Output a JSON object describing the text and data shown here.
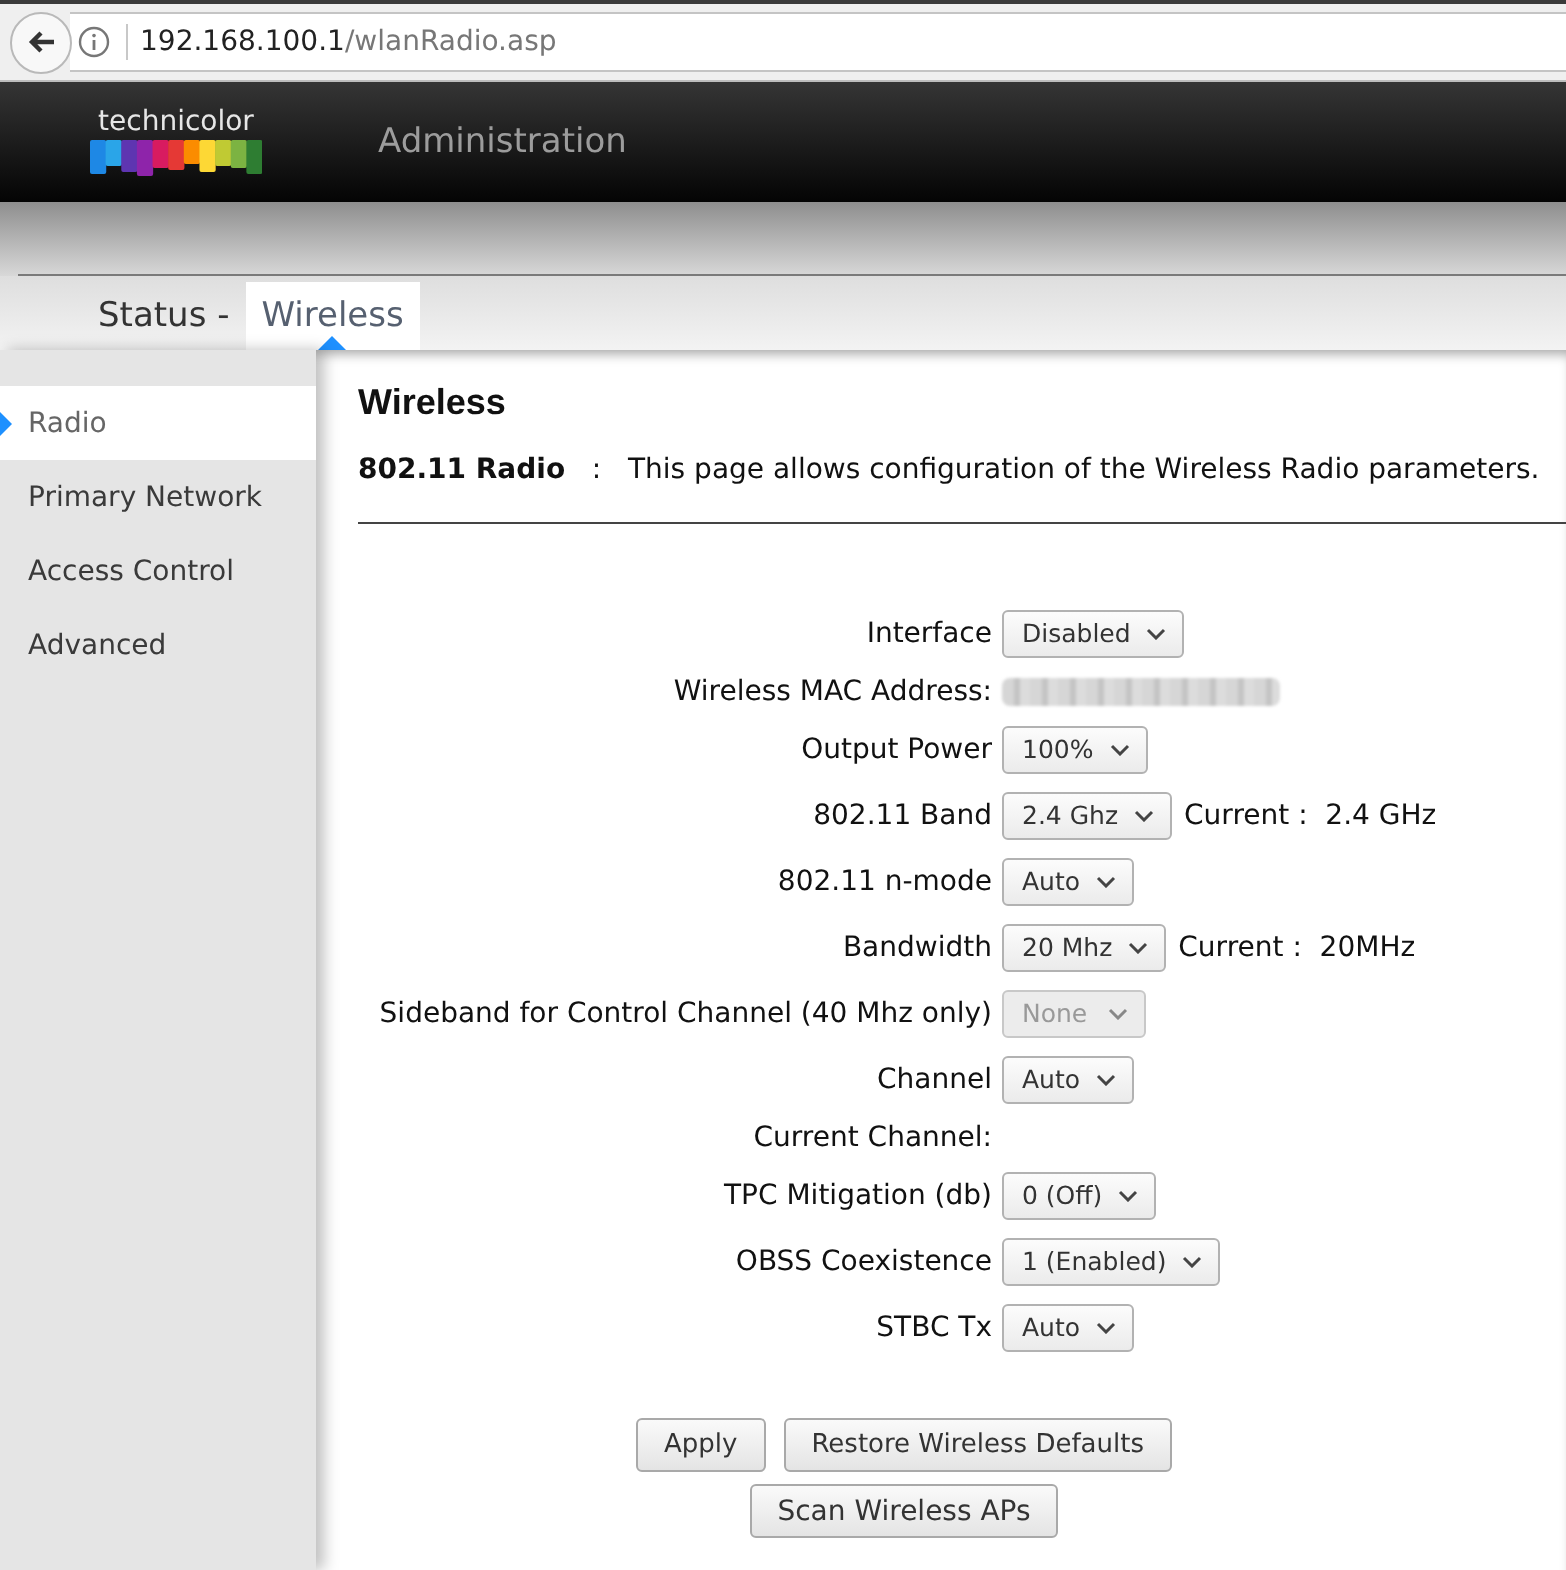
{
  "browser": {
    "url_host": "192.168.100.1",
    "url_path": "/wlanRadio.asp"
  },
  "header": {
    "logo_text": "technicolor",
    "title": "Administration"
  },
  "tabs": [
    {
      "label": "Status -",
      "selected": false
    },
    {
      "label": "Wireless",
      "selected": true
    }
  ],
  "sidebar": {
    "items": [
      {
        "label": "Radio",
        "selected": true
      },
      {
        "label": "Primary Network",
        "selected": false
      },
      {
        "label": "Access Control",
        "selected": false
      },
      {
        "label": "Advanced",
        "selected": false
      }
    ]
  },
  "content": {
    "title": "Wireless",
    "description": "**802.11 Radio**   :   This page allows configuration of the Wireless Radio parameters.",
    "fields": [
      {
        "kind": "select",
        "label": "Interface",
        "value": "Disabled",
        "disabled": false
      },
      {
        "kind": "redacted",
        "label": "Wireless MAC Address:"
      },
      {
        "kind": "select",
        "label": "Output Power",
        "value": "100%",
        "disabled": false
      },
      {
        "kind": "select",
        "label": "802.11 Band",
        "value": "2.4 Ghz",
        "disabled": false,
        "current": "Current :  2.4 GHz"
      },
      {
        "kind": "select",
        "label": "802.11 n-mode",
        "value": "Auto",
        "disabled": false
      },
      {
        "kind": "select",
        "label": "Bandwidth",
        "value": "20 Mhz",
        "disabled": false,
        "current": "Current :  20MHz"
      },
      {
        "kind": "select",
        "label": "Sideband for Control Channel (40 Mhz only)",
        "value": "None",
        "disabled": true
      },
      {
        "kind": "select",
        "label": "Channel",
        "value": "Auto",
        "disabled": false
      },
      {
        "kind": "text",
        "label": "Current Channel:"
      },
      {
        "kind": "select",
        "label": "TPC Mitigation (db)",
        "value": "0 (Off)",
        "disabled": false
      },
      {
        "kind": "select",
        "label": "OBSS Coexistence",
        "value": "1 (Enabled)",
        "disabled": false
      },
      {
        "kind": "select",
        "label": "STBC Tx",
        "value": "Auto",
        "disabled": false
      }
    ],
    "button_rows": [
      [
        "Apply",
        "Restore Wireless Defaults"
      ],
      [
        "Scan Wireless APs"
      ]
    ]
  }
}
